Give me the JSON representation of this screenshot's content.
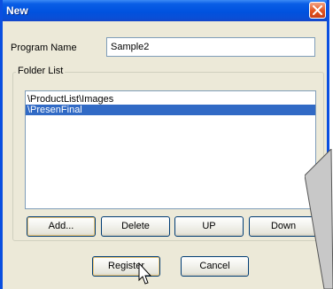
{
  "window": {
    "title": "New"
  },
  "program_name": {
    "label": "Program Name",
    "value": "Sample2"
  },
  "folder_list": {
    "legend": "Folder List",
    "items": [
      {
        "label": "\\ProductList\\Images",
        "selected": false
      },
      {
        "label": "\\PresenFinal",
        "selected": true
      }
    ]
  },
  "buttons": {
    "add": "Add...",
    "delete": "Delete",
    "up": "UP",
    "down": "Down",
    "register": "Register",
    "cancel": "Cancel"
  },
  "colors": {
    "title_bar": "#0052df",
    "selection": "#316ac5",
    "close_button": "#e3531e",
    "dialog_face": "#ece9d8"
  },
  "icons": [
    "close-icon",
    "mouse-pointer-icon"
  ]
}
